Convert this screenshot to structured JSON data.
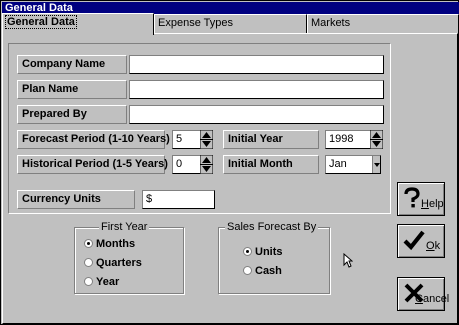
{
  "window": {
    "title": "General Data"
  },
  "tabs": [
    {
      "label": "General Data",
      "active": true
    },
    {
      "label": "Expense Types",
      "active": false
    },
    {
      "label": "Markets",
      "active": false
    }
  ],
  "fields": {
    "company_name": {
      "label": "Company Name",
      "value": ""
    },
    "plan_name": {
      "label": "Plan Name",
      "value": ""
    },
    "prepared_by": {
      "label": "Prepared By",
      "value": ""
    },
    "forecast_period": {
      "label": "Forecast Period (1-10 Years)",
      "value": "5"
    },
    "historical_period": {
      "label": "Historical Period (1-5 Years)",
      "value": "0"
    },
    "initial_year": {
      "label": "Initial Year",
      "value": "1998"
    },
    "initial_month": {
      "label": "Initial Month",
      "value": "Jan"
    },
    "currency_units": {
      "label": "Currency Units",
      "value": "$"
    }
  },
  "first_year": {
    "title": "First Year",
    "options": [
      "Months",
      "Quarters",
      "Year"
    ],
    "selected": "Months"
  },
  "sales_forecast": {
    "title": "Sales Forecast By",
    "options": [
      "Units",
      "Cash"
    ],
    "selected": "Units"
  },
  "buttons": {
    "help": {
      "prefix": "",
      "mnemonic": "H",
      "rest": "elp",
      "icon": "question-mark-icon"
    },
    "ok": {
      "prefix": "",
      "mnemonic": "O",
      "rest": "k",
      "icon": "checkmark-icon"
    },
    "cancel": {
      "prefix": "",
      "mnemonic": "C",
      "rest": "ancel",
      "icon": "x-mark-icon"
    }
  },
  "colors": {
    "titlebar": "#000080",
    "face": "#c0c0c0"
  }
}
